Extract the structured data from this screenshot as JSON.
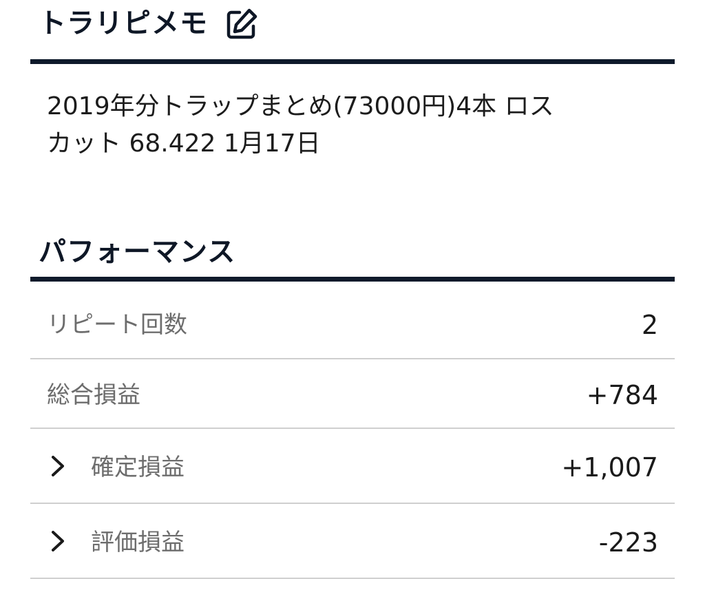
{
  "memo": {
    "title": "トラリピメモ",
    "text": "2019年分トラップまとめ(73000円)4本 ロス\nカット 68.422 1月17日"
  },
  "performance": {
    "title": "パフォーマンス",
    "rows": [
      {
        "label": "リピート回数",
        "value": "2"
      },
      {
        "label": "総合損益",
        "value": "+784"
      },
      {
        "label": "確定損益",
        "value": "+1,007"
      },
      {
        "label": "評価損益",
        "value": "-223"
      }
    ]
  }
}
